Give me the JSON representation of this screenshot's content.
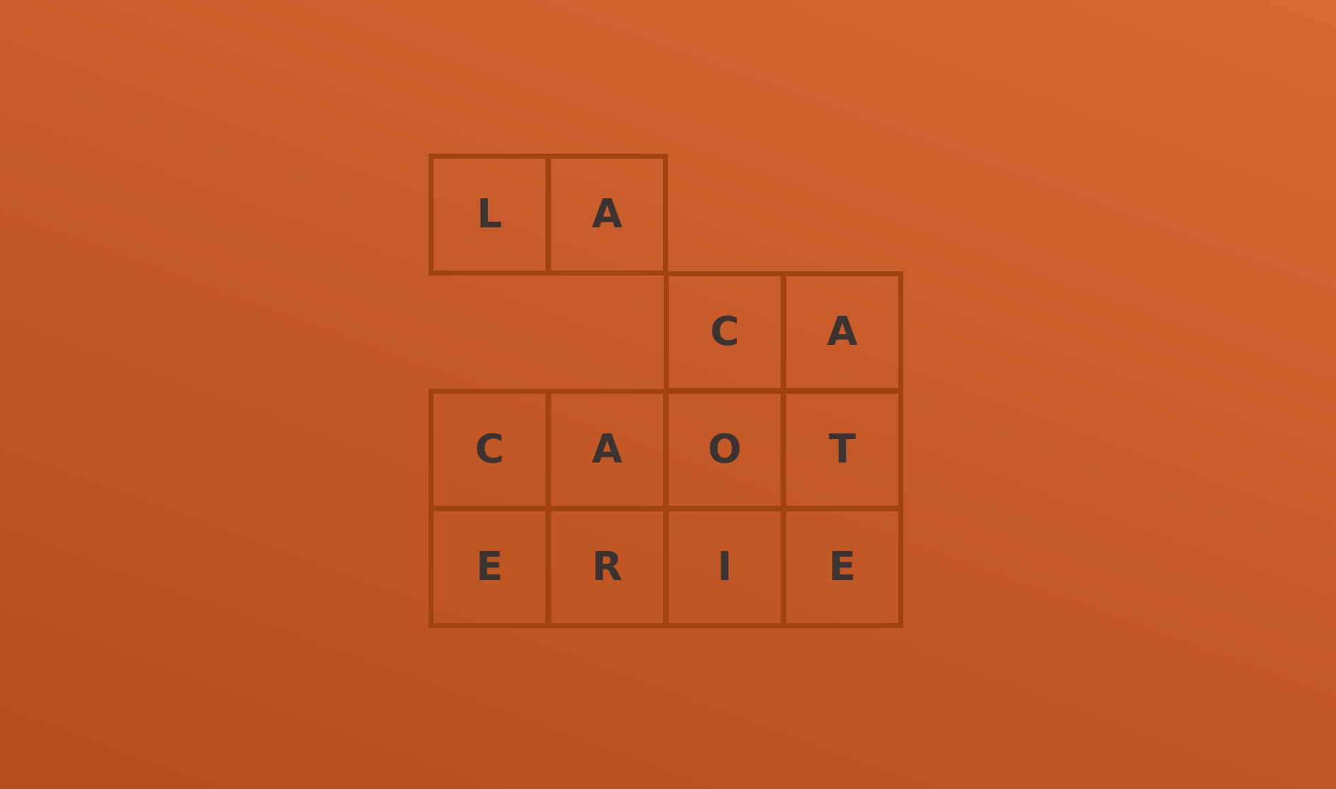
{
  "logo": {
    "rows": [
      [
        "L",
        "A"
      ],
      [
        "C",
        "A"
      ],
      [
        "C",
        "A",
        "O",
        "T"
      ],
      [
        "E",
        "R",
        "I",
        "E"
      ]
    ]
  },
  "colors": {
    "background_top": "#d66a36",
    "background_bottom": "#b44d1a",
    "grid_line": "#a1430f",
    "letters": "#3a3331"
  }
}
